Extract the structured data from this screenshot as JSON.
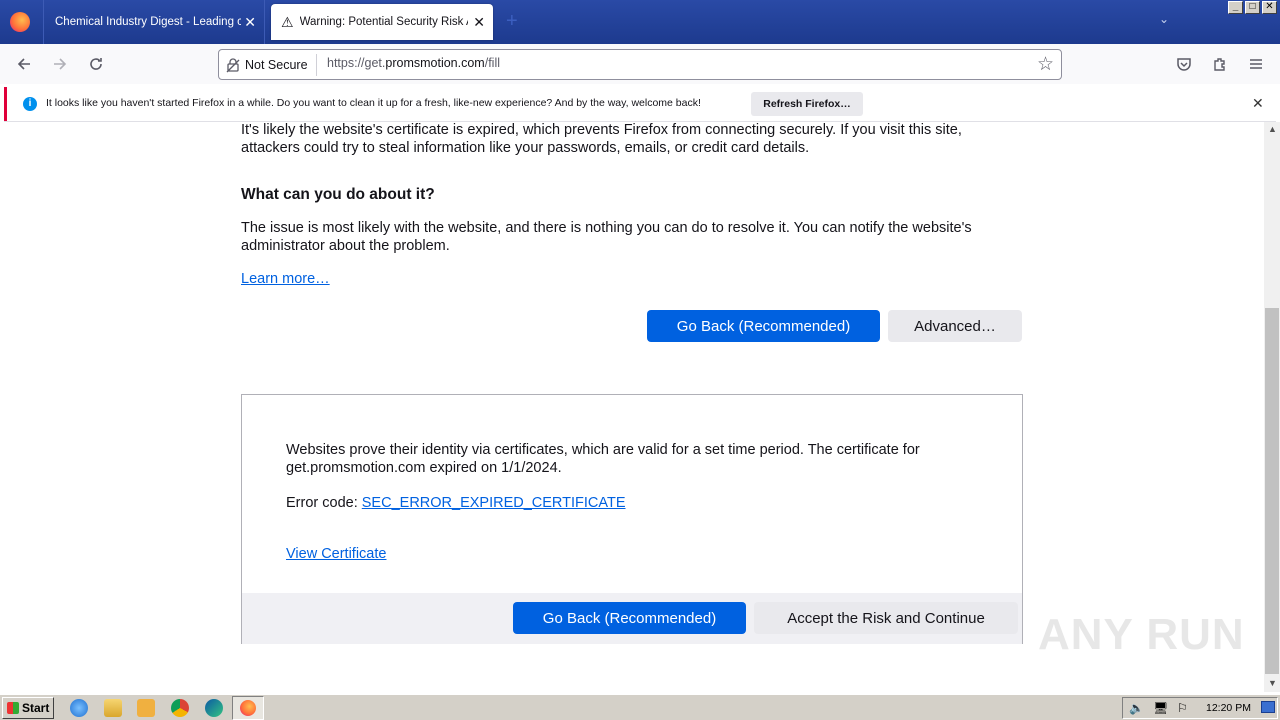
{
  "browser": {
    "tabs": [
      {
        "title": "Chemical Industry Digest - Leading chem",
        "close": "✕"
      },
      {
        "title": "Warning: Potential Security Risk Ah",
        "close": "✕"
      }
    ],
    "new_tab": "+",
    "address": {
      "security_label": "Not Secure",
      "url_prefix": "https://get.",
      "url_host": "promsmotion.com",
      "url_path": "/fill"
    }
  },
  "notification": {
    "text": "It looks like you haven't started Firefox in a while. Do you want to clean it up for a fresh, like-new experience? And by the way, welcome back!",
    "button": "Refresh Firefox…",
    "close": "✕"
  },
  "page": {
    "intro_text": "It's likely the website's certificate is expired, which prevents Firefox from connecting securely. If you visit this site, attackers could try to steal information like your passwords, emails, or credit card details.",
    "what_heading": "What can you do about it?",
    "what_text": "The issue is most likely with the website, and there is nothing you can do to resolve it. You can notify the website's administrator about the problem.",
    "learn_more": "Learn more…",
    "go_back": "Go Back (Recommended)",
    "advanced": "Advanced…",
    "advanced_panel": {
      "cert_text": "Websites prove their identity via certificates, which are valid for a set time period. The certificate for get.promsmotion.com expired on 1/1/2024.",
      "error_label": "Error code:",
      "error_code": "SEC_ERROR_EXPIRED_CERTIFICATE",
      "view_cert": "View Certificate",
      "go_back": "Go Back (Recommended)",
      "accept": "Accept the Risk and Continue"
    }
  },
  "watermark": "ANY RUN",
  "taskbar": {
    "start": "Start",
    "clock": "12:20 PM"
  }
}
